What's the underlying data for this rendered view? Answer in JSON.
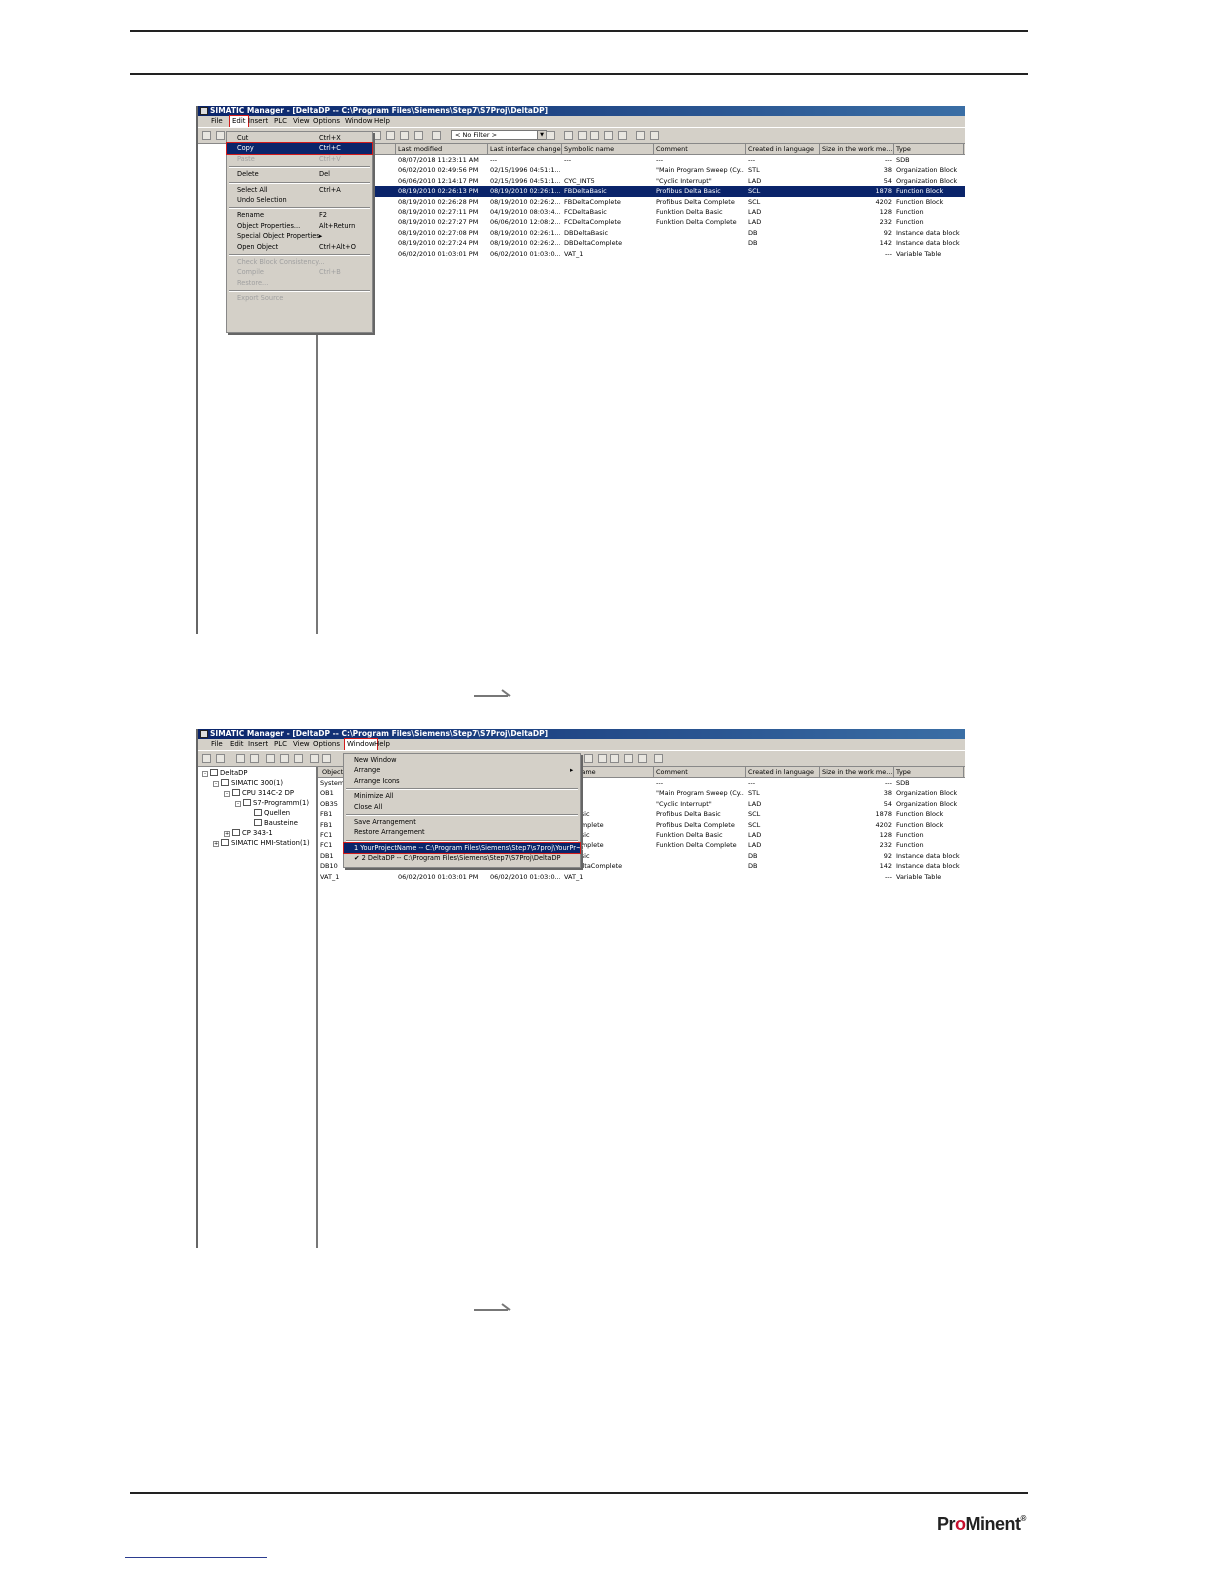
{
  "window1": {
    "title": "SIMATIC Manager - [DeltaDP -- C:\\Program Files\\Siemens\\Step7\\S7Proj\\DeltaDP]",
    "menu": [
      "File",
      "Edit",
      "Insert",
      "PLC",
      "View",
      "Options",
      "Window",
      "Help"
    ],
    "filter": "< No Filter >",
    "edit_menu": [
      {
        "label": "Cut",
        "shortcut": "Ctrl+X",
        "state": "normal"
      },
      {
        "label": "Copy",
        "shortcut": "Ctrl+C",
        "state": "active"
      },
      {
        "label": "Paste",
        "shortcut": "Ctrl+V",
        "state": "disabled"
      },
      {
        "sep": true
      },
      {
        "label": "Delete",
        "shortcut": "Del",
        "state": "normal"
      },
      {
        "sep": true
      },
      {
        "label": "Select All",
        "shortcut": "Ctrl+A",
        "state": "normal"
      },
      {
        "label": "Undo Selection",
        "shortcut": "",
        "state": "normal"
      },
      {
        "sep": true
      },
      {
        "label": "Rename",
        "shortcut": "F2",
        "state": "normal"
      },
      {
        "label": "Object Properties...",
        "shortcut": "Alt+Return",
        "state": "normal"
      },
      {
        "label": "Special Object Properties",
        "shortcut": "▸",
        "state": "normal"
      },
      {
        "label": "Open Object",
        "shortcut": "Ctrl+Alt+O",
        "state": "normal"
      },
      {
        "sep": true
      },
      {
        "label": "Check Block Consistency...",
        "shortcut": "",
        "state": "disabled"
      },
      {
        "label": "Compile",
        "shortcut": "Ctrl+B",
        "state": "disabled"
      },
      {
        "label": "Restore...",
        "shortcut": "",
        "state": "disabled"
      },
      {
        "sep": true
      },
      {
        "label": "Export Source",
        "shortcut": "",
        "state": "disabled"
      }
    ],
    "rows": [
      {
        "object": "",
        "modified": "08/07/2018 11:23:11 AM",
        "iface": "---",
        "symbol": "---",
        "comment": "---",
        "lang": "---",
        "size": "---",
        "type": "SDB",
        "sel": false
      },
      {
        "object": "",
        "modified": "06/02/2010 02:49:56 PM",
        "iface": "02/15/1996 04:51:1...",
        "symbol": "",
        "comment": "\"Main Program Sweep (Cy...",
        "lang": "STL",
        "size": "38",
        "type": "Organization Block",
        "sel": false
      },
      {
        "object": "",
        "modified": "06/06/2010 12:14:17 PM",
        "iface": "02/15/1996 04:51:1...",
        "symbol": "CYC_INT5",
        "comment": "\"Cyclic Interrupt\"",
        "lang": "LAD",
        "size": "54",
        "type": "Organization Block",
        "sel": false
      },
      {
        "object": "",
        "modified": "08/19/2010 02:26:13 PM",
        "iface": "08/19/2010 02:26:1...",
        "symbol": "FBDeltaBasic",
        "comment": "Profibus Delta Basic",
        "lang": "SCL",
        "size": "1878",
        "type": "Function Block",
        "sel": true
      },
      {
        "object": "",
        "modified": "08/19/2010 02:26:28 PM",
        "iface": "08/19/2010 02:26:2...",
        "symbol": "FBDeltaComplete",
        "comment": "Profibus Delta Complete",
        "lang": "SCL",
        "size": "4202",
        "type": "Function Block",
        "sel": false
      },
      {
        "object": "",
        "modified": "08/19/2010 02:27:11 PM",
        "iface": "04/19/2010 08:03:4...",
        "symbol": "FCDeltaBasic",
        "comment": "Funktion Delta Basic",
        "lang": "LAD",
        "size": "128",
        "type": "Function",
        "sel": false
      },
      {
        "object": "",
        "modified": "08/19/2010 02:27:27 PM",
        "iface": "06/06/2010 12:08:2...",
        "symbol": "FCDeltaComplete",
        "comment": "Funktion Delta Complete",
        "lang": "LAD",
        "size": "232",
        "type": "Function",
        "sel": false
      },
      {
        "object": "",
        "modified": "08/19/2010 02:27:08 PM",
        "iface": "08/19/2010 02:26:1...",
        "symbol": "DBDeltaBasic",
        "comment": "",
        "lang": "DB",
        "size": "92",
        "type": "Instance data block ...",
        "sel": false
      },
      {
        "object": "",
        "modified": "08/19/2010 02:27:24 PM",
        "iface": "08/19/2010 02:26:2...",
        "symbol": "DBDeltaComplete",
        "comment": "",
        "lang": "DB",
        "size": "142",
        "type": "Instance data block ...",
        "sel": false
      },
      {
        "object": "",
        "modified": "06/02/2010 01:03:01 PM",
        "iface": "06/02/2010 01:03:0...",
        "symbol": "VAT_1",
        "comment": "",
        "lang": "",
        "size": "---",
        "type": "Variable Table",
        "sel": false
      }
    ]
  },
  "window2": {
    "title": "SIMATIC Manager - [DeltaDP -- C:\\Program Files\\Siemens\\Step7\\S7Proj\\DeltaDP]",
    "menu": [
      "File",
      "Edit",
      "Insert",
      "PLC",
      "View",
      "Options",
      "Window",
      "Help"
    ],
    "tree": [
      {
        "label": "DeltaDP",
        "level": 0,
        "pm": "-"
      },
      {
        "label": "SIMATIC 300(1)",
        "level": 1,
        "pm": "-"
      },
      {
        "label": "CPU 314C-2 DP",
        "level": 2,
        "pm": "-"
      },
      {
        "label": "S7-Programm(1)",
        "level": 3,
        "pm": "-"
      },
      {
        "label": "Quellen",
        "level": 4,
        "pm": ""
      },
      {
        "label": "Bausteine",
        "level": 4,
        "pm": ""
      },
      {
        "label": "CP 343-1",
        "level": 2,
        "pm": "+"
      },
      {
        "label": "SIMATIC HMI-Station(1)",
        "level": 1,
        "pm": "+"
      }
    ],
    "window_menu": [
      {
        "label": "New Window",
        "state": "normal"
      },
      {
        "label": "Arrange",
        "state": "normal",
        "sub": "▸"
      },
      {
        "label": "Arrange Icons",
        "state": "normal"
      },
      {
        "sep": true
      },
      {
        "label": "Minimize All",
        "state": "normal"
      },
      {
        "label": "Close All",
        "state": "normal"
      },
      {
        "sep": true
      },
      {
        "label": "Save Arrangement",
        "state": "normal"
      },
      {
        "label": "Restore Arrangement",
        "state": "normal"
      },
      {
        "sep": true
      },
      {
        "label": "1 YourProjectName -- C:\\Program Files\\Siemens\\Step7\\s7proj\\YourPr~1",
        "state": "active"
      },
      {
        "label": "✔ 2 DeltaDP -- C:\\Program Files\\Siemens\\Step7\\S7Proj\\DeltaDP",
        "state": "normal"
      }
    ],
    "objects": [
      "System data",
      "OB1",
      "OB35",
      "FB1",
      "FB1",
      "FC1",
      "FC1",
      "DB1",
      "DB10",
      "VAT_1"
    ],
    "rows": [
      {
        "modified": "",
        "iface": "",
        "symbol": "",
        "comment": "---",
        "lang": "---",
        "size": "---",
        "type": "SDB"
      },
      {
        "modified": "",
        "iface": "",
        "symbol": "",
        "comment": "\"Main Program Sweep (Cy...",
        "lang": "STL",
        "size": "38",
        "type": "Organization Block"
      },
      {
        "modified": "",
        "iface": "",
        "symbol": "INT5",
        "comment": "\"Cyclic Interrupt\"",
        "lang": "LAD",
        "size": "54",
        "type": "Organization Block"
      },
      {
        "modified": "",
        "iface": "",
        "symbol": "ltaBasic",
        "comment": "Profibus Delta Basic",
        "lang": "SCL",
        "size": "1878",
        "type": "Function Block"
      },
      {
        "modified": "",
        "iface": "",
        "symbol": "ltaComplete",
        "comment": "Profibus Delta Complete",
        "lang": "SCL",
        "size": "4202",
        "type": "Function Block"
      },
      {
        "modified": "",
        "iface": "",
        "symbol": "ltaBasic",
        "comment": "Funktion Delta Basic",
        "lang": "LAD",
        "size": "128",
        "type": "Function"
      },
      {
        "modified": "",
        "iface": "",
        "symbol": "ltaComplete",
        "comment": "Funktion Delta Complete",
        "lang": "LAD",
        "size": "232",
        "type": "Function"
      },
      {
        "modified": "",
        "iface": "",
        "symbol": "ltaBasic",
        "comment": "",
        "lang": "DB",
        "size": "92",
        "type": "Instance data block ..."
      },
      {
        "modified": "08/19/2010 02:27:24 PM",
        "iface": "08/19/2010 02:26:2...",
        "symbol": "DBDeltaComplete",
        "comment": "",
        "lang": "DB",
        "size": "142",
        "type": "Instance data block ..."
      },
      {
        "modified": "06/02/2010 01:03:01 PM",
        "iface": "06/02/2010 01:03:0...",
        "symbol": "VAT_1",
        "comment": "",
        "lang": "",
        "size": "---",
        "type": "Variable Table"
      }
    ]
  },
  "headers": [
    "Object name",
    "Last modified",
    "Last interface change",
    "Symbolic name",
    "Comment",
    "Created in language",
    "Size in the work me...",
    "Type"
  ],
  "headers2": [
    "Object",
    "",
    "",
    "olic name",
    "Comment",
    "Created in language",
    "Size in the work me...",
    "Type"
  ],
  "logo": {
    "pre": "Pr",
    "o": "o",
    "post": "Minent",
    "reg": "®"
  },
  "colors": {
    "highlight": "#0a246a",
    "annotation": "#d21b1b",
    "chrome": "#d4d0c8"
  }
}
